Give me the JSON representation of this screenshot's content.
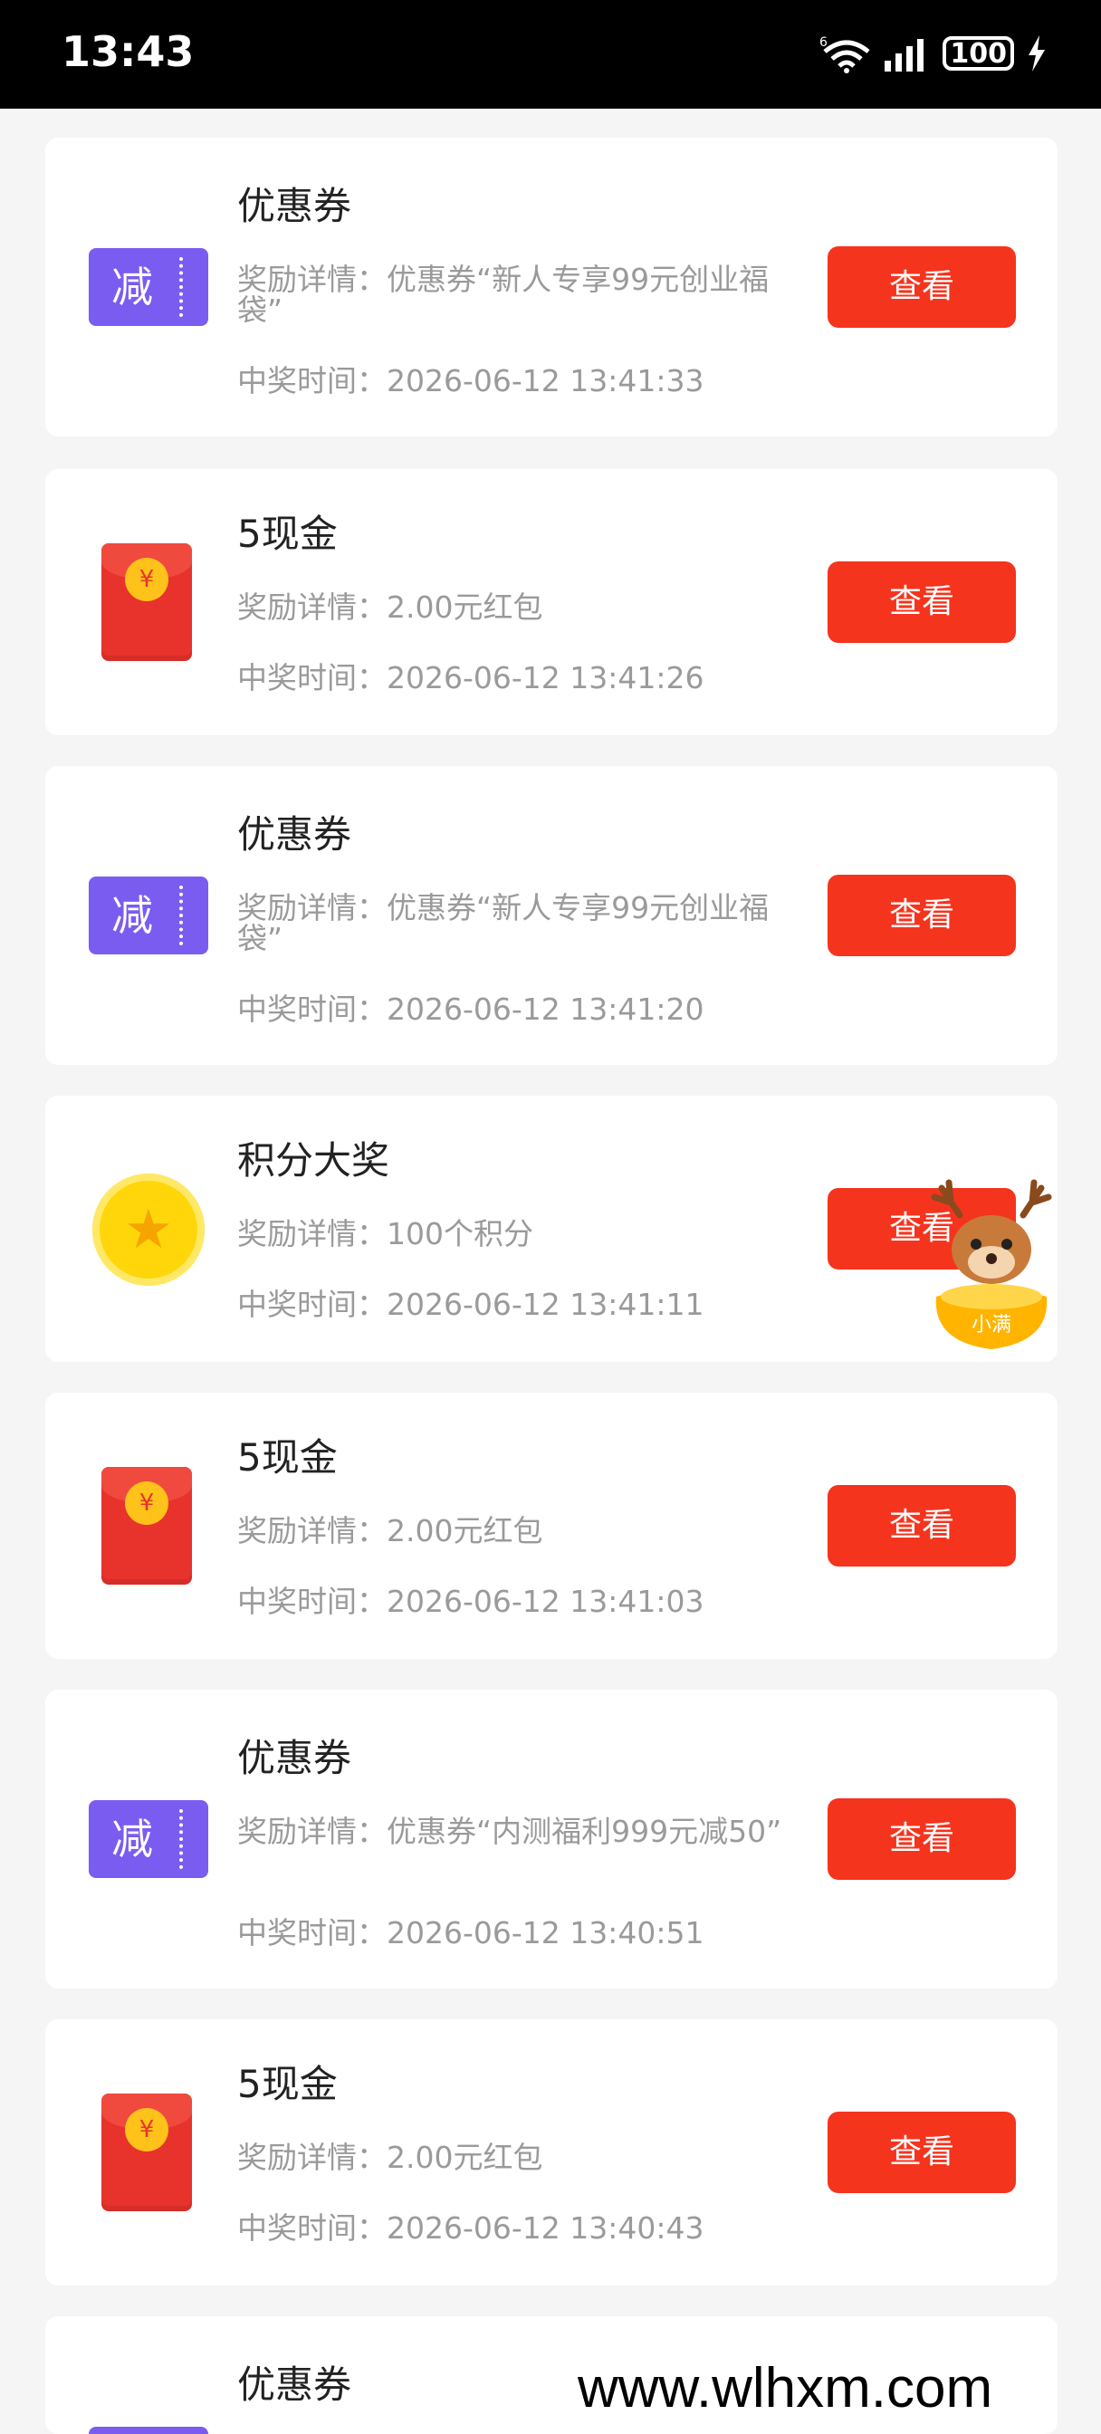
{
  "status_bar": {
    "time": "13:43",
    "wifi_label": "6",
    "battery": "100"
  },
  "rewards": [
    {
      "type": "coupon",
      "icon_glyph": "减",
      "title": "优惠券",
      "detail": "奖励详情：优惠券“新人专享99元创业福袋”",
      "time": "中奖时间：2026-06-12 13:41:33",
      "button": "查看"
    },
    {
      "type": "red-packet",
      "icon_glyph": "¥",
      "title": "5现金",
      "detail": "奖励详情：2.00元红包",
      "time": "中奖时间：2026-06-12 13:41:26",
      "button": "查看"
    },
    {
      "type": "coupon",
      "icon_glyph": "减",
      "title": "优惠券",
      "detail": "奖励详情：优惠券“新人专享99元创业福袋”",
      "time": "中奖时间：2026-06-12 13:41:20",
      "button": "查看"
    },
    {
      "type": "points",
      "icon_glyph": "★",
      "title": "积分大奖",
      "detail": "奖励详情：100个积分",
      "time": "中奖时间：2026-06-12 13:41:11",
      "button": "查看"
    },
    {
      "type": "red-packet",
      "icon_glyph": "¥",
      "title": "5现金",
      "detail": "奖励详情：2.00元红包",
      "time": "中奖时间：2026-06-12 13:41:03",
      "button": "查看"
    },
    {
      "type": "coupon",
      "icon_glyph": "减",
      "title": "优惠券",
      "detail": "奖励详情：优惠券“内测福利999元减50”",
      "time": "中奖时间：2026-06-12 13:40:51",
      "button": "查看"
    },
    {
      "type": "red-packet",
      "icon_glyph": "¥",
      "title": "5现金",
      "detail": "奖励详情：2.00元红包",
      "time": "中奖时间：2026-06-12 13:40:43",
      "button": "查看"
    },
    {
      "type": "coupon",
      "icon_glyph": "减",
      "title": "优惠券",
      "detail": "",
      "time": "",
      "button": ""
    }
  ],
  "mascot": {
    "label": "小满"
  },
  "watermark": "www.wlhxm.com",
  "colors": {
    "accent": "#f5341e",
    "coupon": "#7b5cf0",
    "red_packet": "#e8322c",
    "points": "#ffd60a"
  }
}
